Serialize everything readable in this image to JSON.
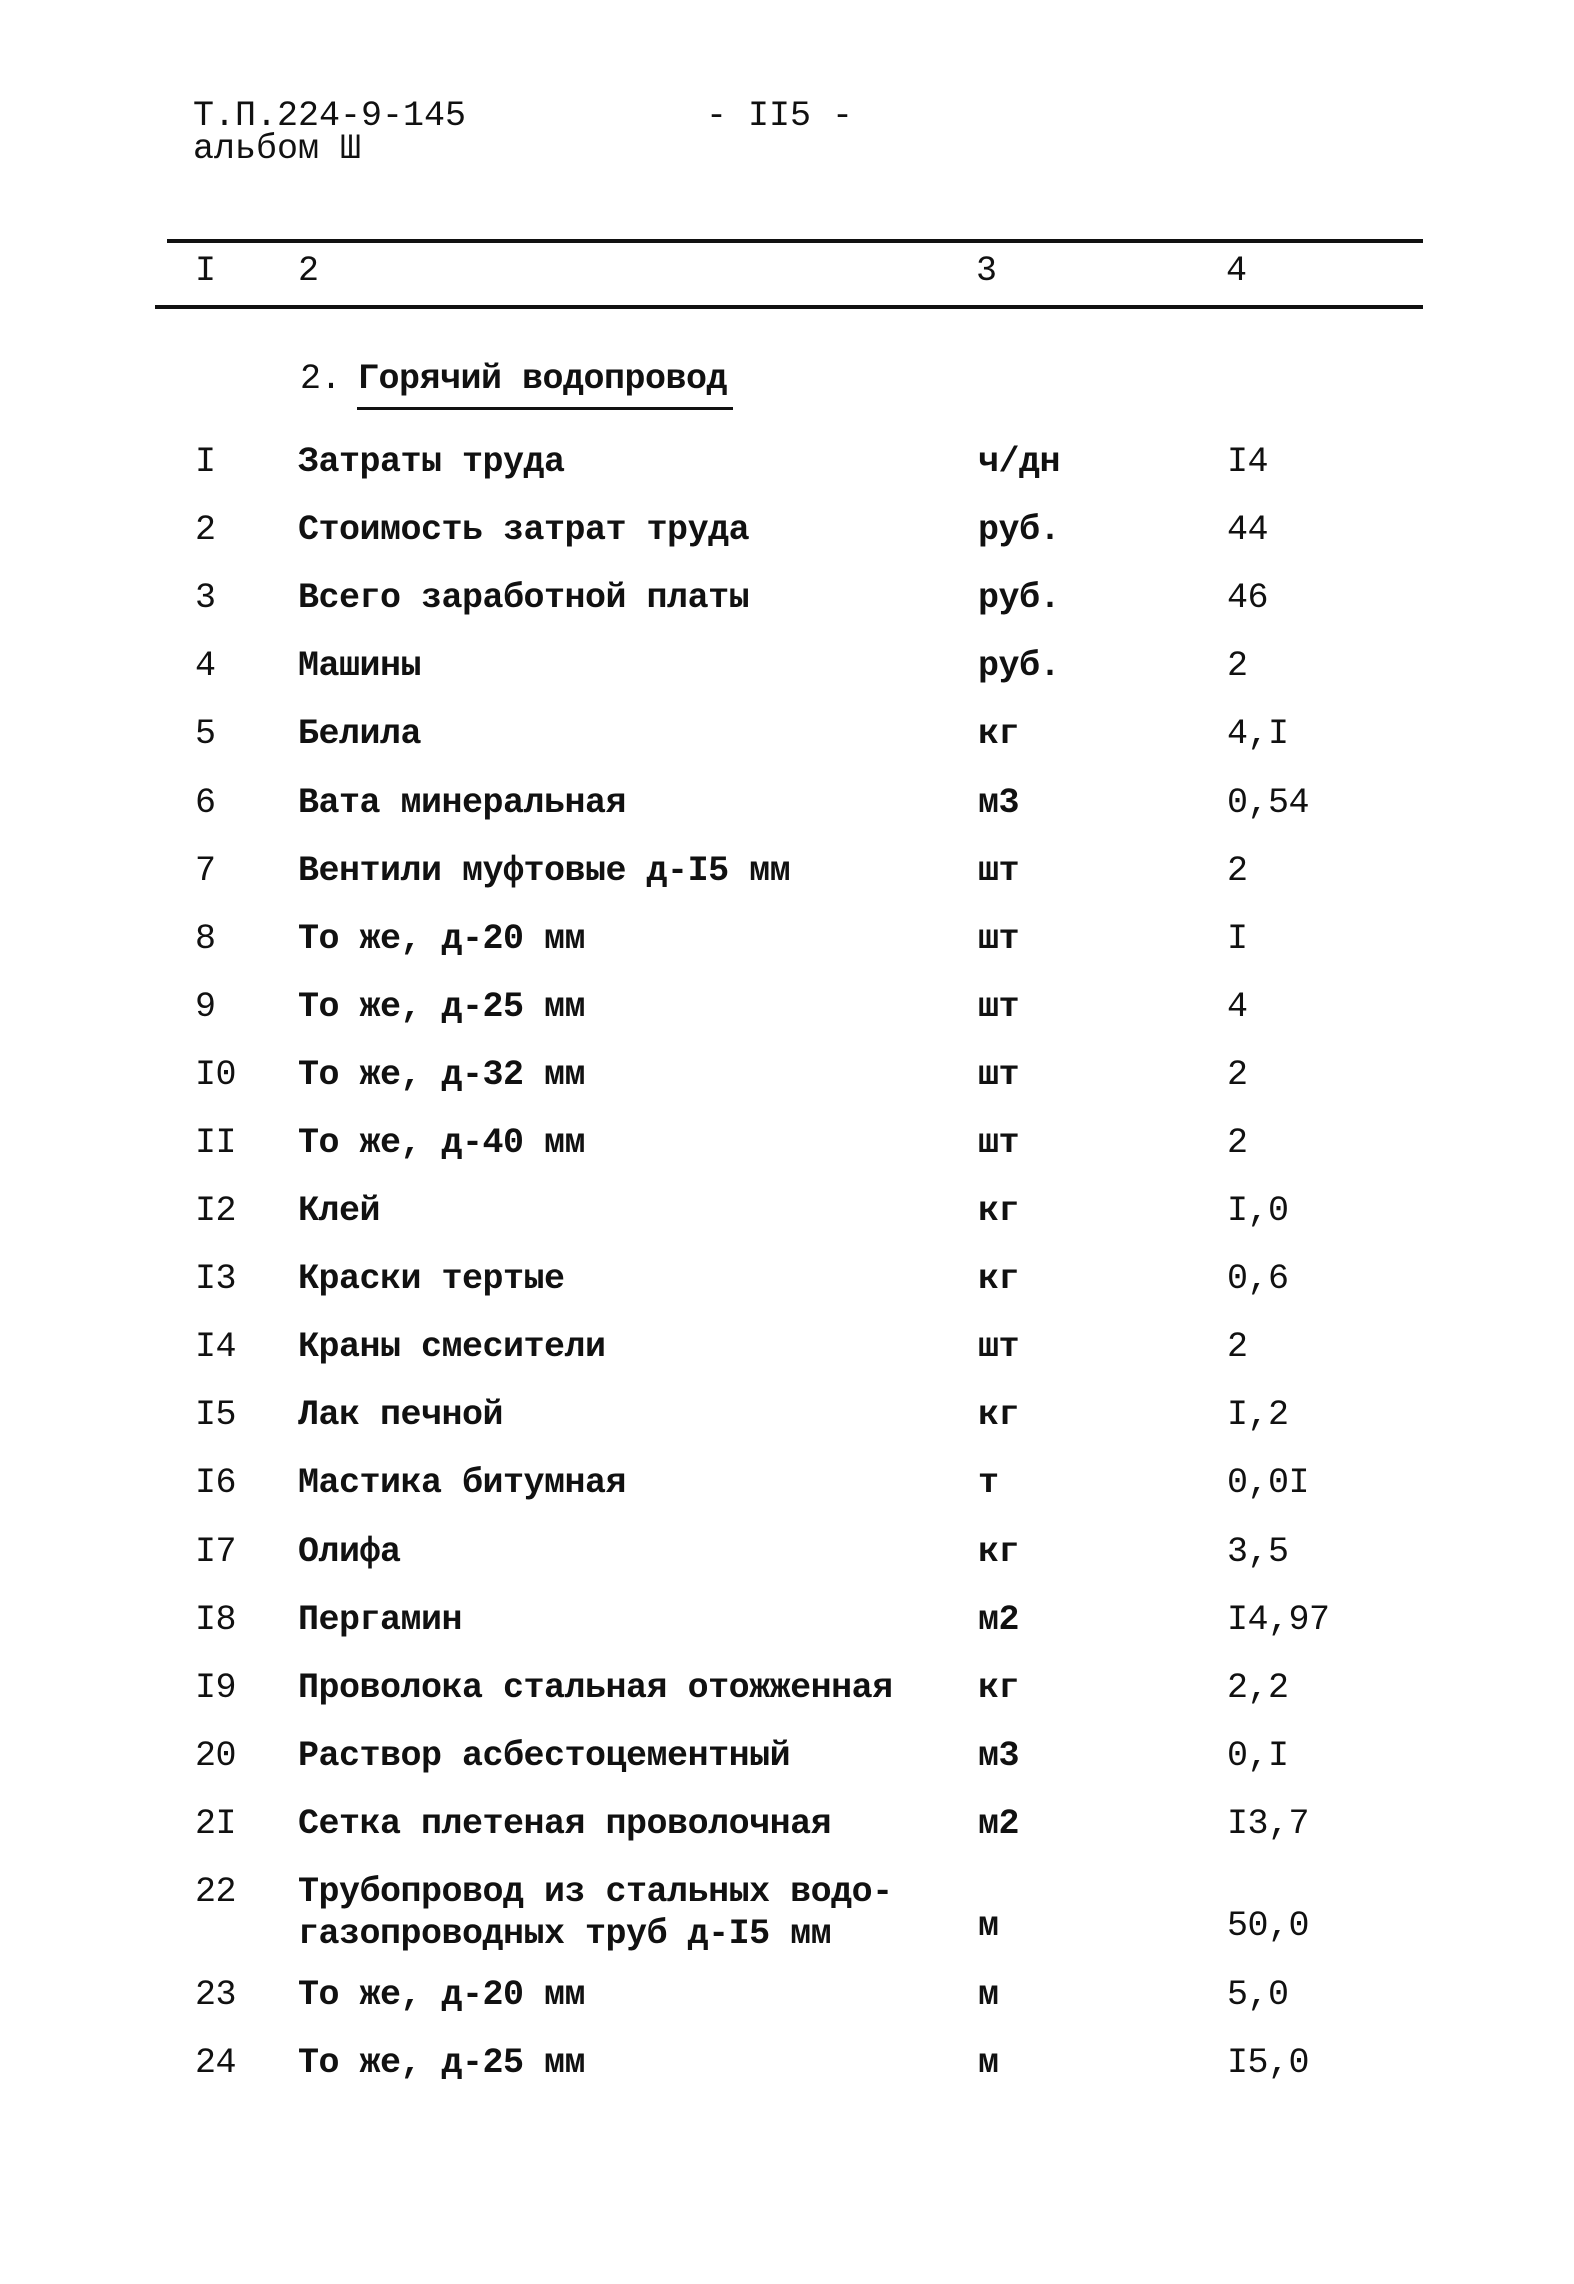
{
  "header": {
    "doc_code": "Т.П.224-9-145",
    "album": "альбом Ш",
    "page_number": "- II5 -"
  },
  "table_header": {
    "col1": "I",
    "col2": "2",
    "col3": "3",
    "col4": "4"
  },
  "section": {
    "number": "2.",
    "title": "Горячий водопровод"
  },
  "rows": [
    {
      "n": "I",
      "name": "Затраты труда",
      "unit": "ч/дн",
      "value": "I4"
    },
    {
      "n": "2",
      "name": "Стоимость затрат труда",
      "unit": "руб.",
      "value": "44"
    },
    {
      "n": "3",
      "name": "Всего заработной платы",
      "unit": "руб.",
      "value": "46"
    },
    {
      "n": "4",
      "name": "Машины",
      "unit": "руб.",
      "value": "2"
    },
    {
      "n": "5",
      "name": "Белила",
      "unit": "кг",
      "value": "4,I"
    },
    {
      "n": "6",
      "name": "Вата минеральная",
      "unit": "м3",
      "value": "0,54"
    },
    {
      "n": "7",
      "name": "Вентили муфтовые д-I5 мм",
      "unit": "шт",
      "value": "2"
    },
    {
      "n": "8",
      "name": "То же, д-20 мм",
      "unit": "шт",
      "value": "I"
    },
    {
      "n": "9",
      "name": "То же, д-25 мм",
      "unit": "шт",
      "value": "4"
    },
    {
      "n": "I0",
      "name": "То же, д-32 мм",
      "unit": "шт",
      "value": "2"
    },
    {
      "n": "II",
      "name": "То же, д-40 мм",
      "unit": "шт",
      "value": "2"
    },
    {
      "n": "I2",
      "name": "Клей",
      "unit": "кг",
      "value": "I,0"
    },
    {
      "n": "I3",
      "name": "Краски тертые",
      "unit": "кг",
      "value": "0,6"
    },
    {
      "n": "I4",
      "name": "Краны смесители",
      "unit": "шт",
      "value": "2"
    },
    {
      "n": "I5",
      "name": "Лак печной",
      "unit": "кг",
      "value": "I,2"
    },
    {
      "n": "I6",
      "name": "Мастика битумная",
      "unit": "т",
      "value": "0,0I"
    },
    {
      "n": "I7",
      "name": "Олифа",
      "unit": "кг",
      "value": "3,5"
    },
    {
      "n": "I8",
      "name": "Пергамин",
      "unit": "м2",
      "value": "I4,97"
    },
    {
      "n": "I9",
      "name": "Проволока стальная отожженная",
      "unit": "кг",
      "value": "2,2"
    },
    {
      "n": "20",
      "name": "Раствор асбестоцементный",
      "unit": "м3",
      "value": "0,I"
    },
    {
      "n": "2I",
      "name": "Сетка плетеная проволочная",
      "unit": "м2",
      "value": "I3,7"
    },
    {
      "n": "22",
      "name": "Трубопровод из стальных водо-",
      "name_line2": "газопроводных труб д-I5 мм",
      "unit": "м",
      "value": "50,0"
    },
    {
      "n": "23",
      "name": "То же, д-20 мм",
      "unit": "м",
      "value": "5,0"
    },
    {
      "n": "24",
      "name": "То же, д-25 мм",
      "unit": "м",
      "value": "I5,0"
    }
  ]
}
